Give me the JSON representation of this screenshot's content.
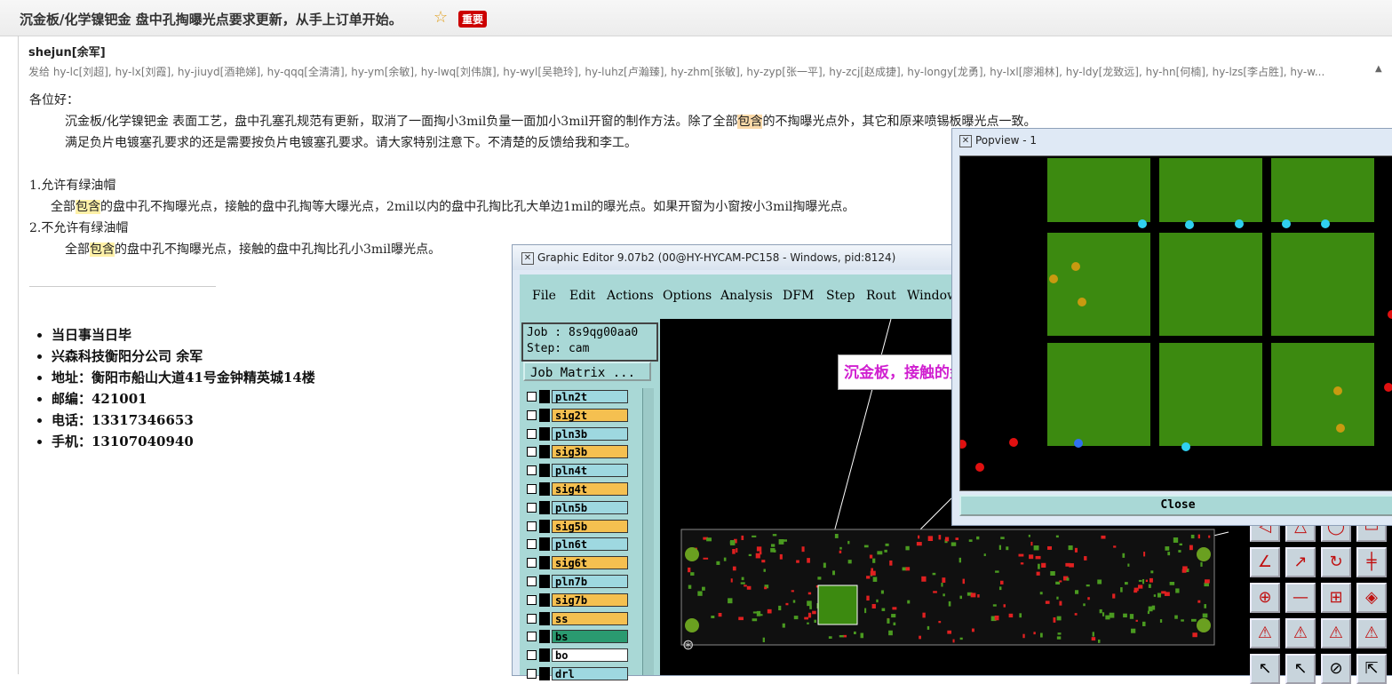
{
  "header": {
    "subject": "沉金板/化学镍钯金 盘中孔掏曝光点要求更新，从手上订单开始。",
    "badge": "重要"
  },
  "sender": "shejun[余军]",
  "recipients": "发给 hy-lc[刘超], hy-lx[刘霞], hy-jiuyd[酒艳娣], hy-qqq[全清清], hy-ym[余敏], hy-lwq[刘伟旗], hy-wyl[吴艳玲], hy-luhz[卢瀚臻], hy-zhm[张敏], hy-zyp[张一平], hy-zcj[赵成捷], hy-longy[龙勇], hy-lxl[廖湘林], hy-ldy[龙致远], hy-hn[何楠], hy-lzs[李占胜], hy-w...",
  "body": {
    "greeting": "各位好：",
    "p1_a": "沉金板/化学镍钯金 表面工艺，盘中孔塞孔规范有更新，取消了一面掏小3mil负量一面加小3mil开窗的制作方法。除了全部",
    "p1_hl": "包含",
    "p1_b": "的不掏曝光点外，其它和原来喷锡板曝光点一致。",
    "p2": "满足负片电镀塞孔要求的还是需要按负片电镀塞孔要求。请大家特别注意下。不清楚的反馈给我和李工。",
    "item1": "1.允许有绿油帽",
    "item1_a": "全部",
    "item1_hl": "包含",
    "item1_b": "的盘中孔不掏曝光点，接触的盘中孔掏等大曝光点，2mil以内的盘中孔掏比孔大单边1mil的曝光点。如果开窗为小窗按小3mil掏曝光点。",
    "item2": "2.不允许有绿油帽",
    "item2_a": "全部",
    "item2_hl": "包含",
    "item2_b": "的盘中孔不掏曝光点，接触的盘中孔掏比孔小3mil曝光点。"
  },
  "signature": [
    "当日事当日毕",
    "兴森科技衡阳分公司 余军",
    "地址：衡阳市船山大道41号金钟精英城14楼",
    "邮编：421001",
    "电话：13317346653",
    "手机：13107040940"
  ],
  "editor": {
    "title": "Graphic Editor 9.07b2 (00@HY-HYCAM-PC158 - Windows, pid:8124)",
    "menu": [
      "File",
      "Edit",
      "Actions",
      "Options",
      "Analysis",
      "DFM",
      "Step",
      "Rout",
      "Window"
    ],
    "job": "Job : 8s9qg00aa0",
    "step": "Step: cam",
    "matrix_button": "Job Matrix ...",
    "layers": [
      {
        "name": "pln2t",
        "color": "#9ed8e0"
      },
      {
        "name": "sig2t",
        "color": "#f5c050"
      },
      {
        "name": "pln3b",
        "color": "#9ed8e0"
      },
      {
        "name": "sig3b",
        "color": "#f5c050"
      },
      {
        "name": "pln4t",
        "color": "#9ed8e0"
      },
      {
        "name": "sig4t",
        "color": "#f5c050"
      },
      {
        "name": "pln5b",
        "color": "#9ed8e0"
      },
      {
        "name": "sig5b",
        "color": "#f5c050"
      },
      {
        "name": "pln6t",
        "color": "#9ed8e0"
      },
      {
        "name": "sig6t",
        "color": "#f5c050"
      },
      {
        "name": "pln7b",
        "color": "#9ed8e0"
      },
      {
        "name": "sig7b",
        "color": "#f5c050"
      },
      {
        "name": "ss",
        "color": "#f5c050"
      },
      {
        "name": "bs",
        "color": "#2a9a70"
      },
      {
        "name": "bo",
        "color": "#ffffff"
      },
      {
        "name": "drl",
        "color": "#9ed8e0"
      }
    ],
    "callout": "沉金板，接触的盘中孔没有掏曝光点；"
  },
  "popview": {
    "title": "Popview - 1",
    "close": "Close"
  }
}
